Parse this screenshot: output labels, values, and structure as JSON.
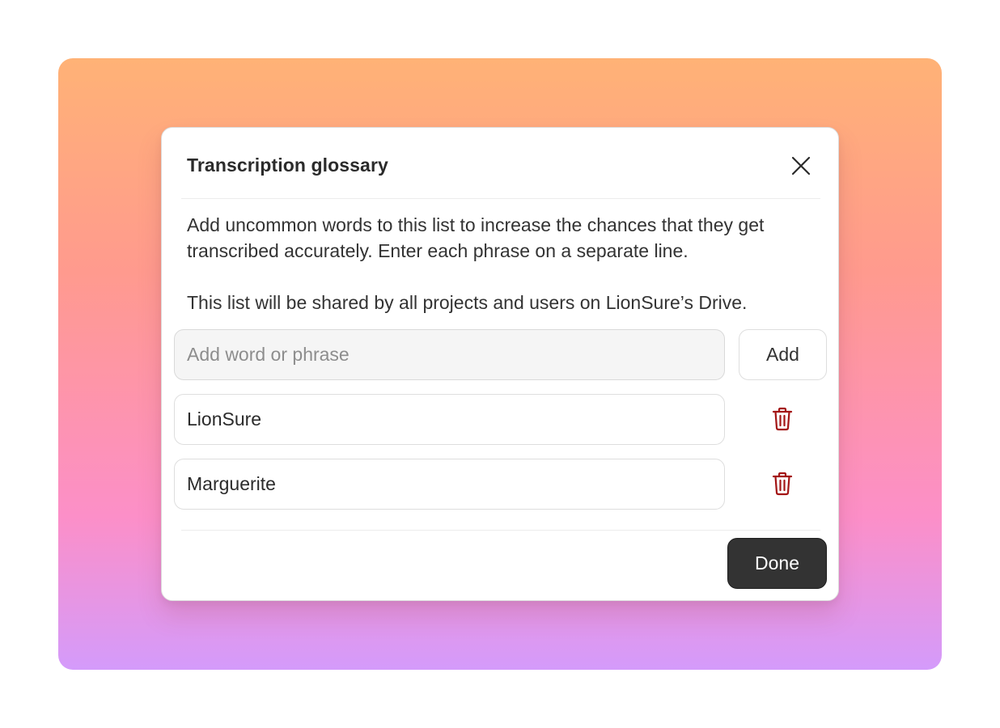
{
  "dialog": {
    "title": "Transcription glossary",
    "description_line1": "Add uncommon words to this list to increase the chances that they get transcribed accurately. Enter each phrase on a separate line.",
    "description_line2": "This list will be shared by all projects and users on LionSure’s Drive.",
    "close_icon": "close-icon"
  },
  "add_row": {
    "placeholder": "Add word or phrase",
    "value": "",
    "button_label": "Add"
  },
  "entries": [
    {
      "value": "LionSure",
      "delete_icon": "trash-icon"
    },
    {
      "value": "Marguerite",
      "delete_icon": "trash-icon"
    }
  ],
  "footer": {
    "done_label": "Done"
  },
  "colors": {
    "gradient_top": "#ffb276",
    "gradient_middle": "#fc8fc8",
    "gradient_bottom": "#d49bfb",
    "trash_icon": "#a31515",
    "done_button": "#333333"
  }
}
